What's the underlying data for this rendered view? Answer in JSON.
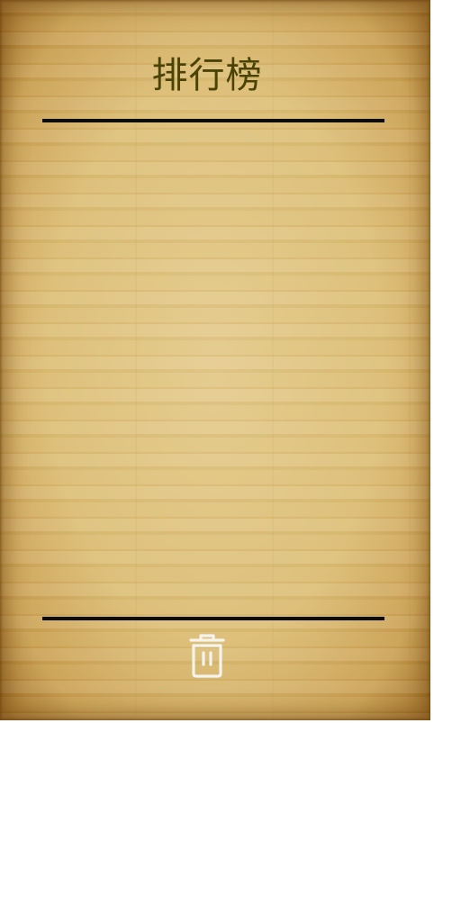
{
  "leaderboard": {
    "title": "排行榜",
    "entries": []
  },
  "footer": {
    "clear_icon": "trash-icon"
  },
  "colors": {
    "title": "#4a4304",
    "divider": "#0c0c08",
    "panel": "#d9b76a",
    "icon_stroke": "#f4f4ee"
  }
}
